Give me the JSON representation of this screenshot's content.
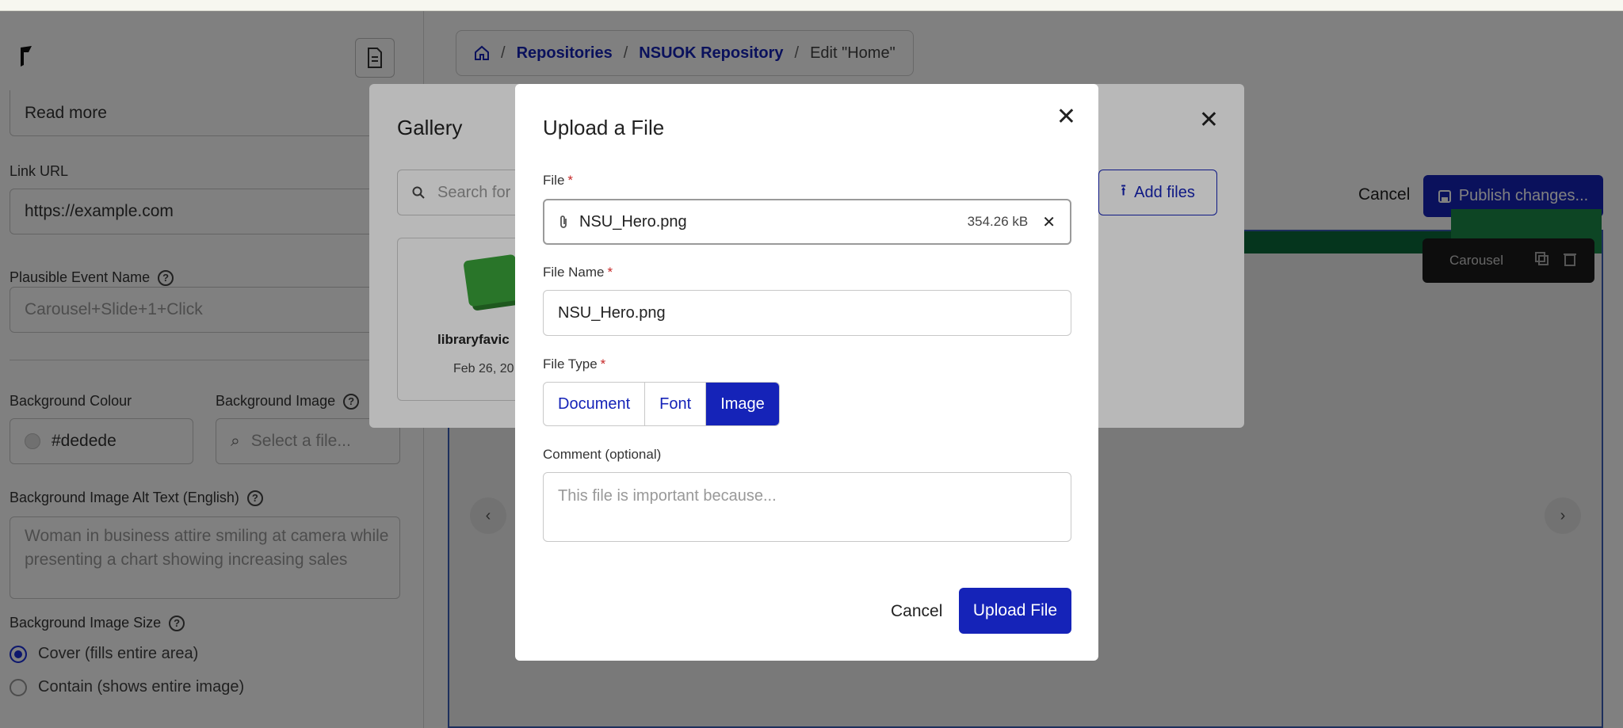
{
  "sidebar": {
    "read_more_value": "Read more",
    "link_url_label": "Link URL",
    "link_url_value": "https://example.com",
    "plausible_label": "Plausible Event Name",
    "plausible_placeholder": "Carousel+Slide+1+Click",
    "bg_colour_label": "Background Colour",
    "bg_colour_value": "#dedede",
    "bg_image_label": "Background Image",
    "bg_image_placeholder": "Select a file...",
    "alt_text_label": "Background Image Alt Text (English)",
    "alt_text_line1": "Woman in business attire smiling at camera while",
    "alt_text_line2": "presenting a chart showing increasing sales",
    "bg_size_label": "Background Image Size",
    "bg_size_cover": "Cover (fills entire area)",
    "bg_size_contain": "Contain (shows entire image)"
  },
  "breadcrumb": {
    "repositories": "Repositories",
    "repo": "NSUOK Repository",
    "current": "Edit \"Home\""
  },
  "main": {
    "cancel_label": "Cancel",
    "publish_label": "Publish changes...",
    "carousel_tag": "Carousel"
  },
  "gallery": {
    "title": "Gallery",
    "search_placeholder": "Search for",
    "add_files_label": "Add files",
    "card_name": "libraryfavic",
    "card_date": "Feb 26, 20"
  },
  "upload_modal": {
    "title": "Upload a File",
    "file_label": "File",
    "file_name_value": "NSU_Hero.png",
    "file_size": "354.26 kB",
    "file_name_label": "File Name",
    "file_name_input": "NSU_Hero.png",
    "file_type_label": "File Type",
    "file_types": [
      "Document",
      "Font",
      "Image"
    ],
    "selected_type": "Image",
    "comment_label": "Comment (optional)",
    "comment_placeholder": "This file is important because...",
    "cancel_label": "Cancel",
    "upload_label": "Upload File"
  },
  "colors": {
    "primary": "#1523b8",
    "required": "#c62828",
    "green": "#0c6b3b"
  }
}
